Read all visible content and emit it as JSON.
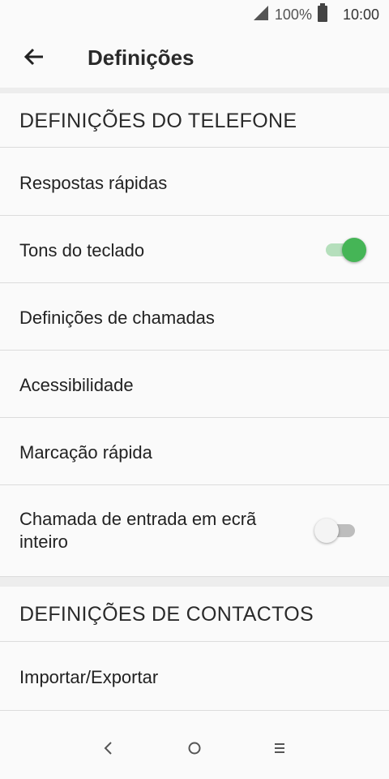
{
  "status_bar": {
    "battery_percent": "100%",
    "time": "10:00",
    "icons": [
      "signal-icon",
      "battery-icon"
    ]
  },
  "app_bar": {
    "title": "Definições",
    "back_icon": "arrow-back-icon"
  },
  "sections": [
    {
      "header": "DEFINIÇÕES DO TELEFONE",
      "items": [
        {
          "label": "Respostas rápidas"
        },
        {
          "label": "Tons do teclado",
          "toggle": true
        },
        {
          "label": "Definições de chamadas"
        },
        {
          "label": "Acessibilidade"
        },
        {
          "label": "Marcação rápida"
        },
        {
          "label": "Chamada de entrada em ecrã inteiro",
          "toggle": false
        }
      ]
    },
    {
      "header": "DEFINIÇÕES DE CONTACTOS",
      "items": [
        {
          "label": "Importar/Exportar"
        }
      ]
    }
  ],
  "nav_bar": {
    "icons": [
      "nav-back-icon",
      "nav-home-icon",
      "nav-recents-icon"
    ]
  },
  "colors": {
    "accent": "#45b556",
    "divider": "#dcdcdc",
    "background": "#fafafa"
  }
}
